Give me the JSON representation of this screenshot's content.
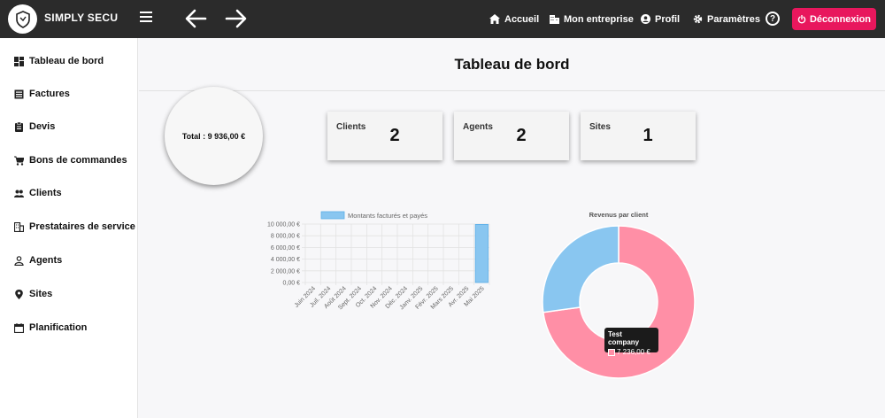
{
  "header": {
    "brand": "SIMPLY SECU",
    "logo_text": "SIMPLY SECU",
    "nav": [
      {
        "label": "Accueil",
        "icon": "home-icon"
      },
      {
        "label": "Mon entreprise",
        "icon": "building-icon"
      },
      {
        "label": "Profil",
        "icon": "user-icon"
      },
      {
        "label": "Paramètres",
        "icon": "gear-icon"
      }
    ],
    "help": "?",
    "logout": "Déconnexion"
  },
  "sidebar": {
    "items": [
      {
        "label": "Tableau de bord",
        "icon": "dashboard-icon"
      },
      {
        "label": "Factures",
        "icon": "invoice-icon"
      },
      {
        "label": "Devis",
        "icon": "clipboard-icon"
      },
      {
        "label": "Bons de commandes",
        "icon": "cart-icon"
      },
      {
        "label": "Clients",
        "icon": "people-icon"
      },
      {
        "label": "Prestataires de service",
        "icon": "building-icon"
      },
      {
        "label": "Agents",
        "icon": "person-icon"
      },
      {
        "label": "Sites",
        "icon": "pin-icon"
      },
      {
        "label": "Planification",
        "icon": "calendar-icon"
      }
    ]
  },
  "main": {
    "title": "Tableau de bord",
    "total": "Total : 9 936,00 €",
    "cards": [
      {
        "label": "Clients",
        "value": "2"
      },
      {
        "label": "Agents",
        "value": "2"
      },
      {
        "label": "Sites",
        "value": "1"
      }
    ]
  },
  "chart_data": [
    {
      "type": "bar",
      "legend": "Montants facturés et payés",
      "categories": [
        "Juin 2024",
        "Juil. 2024",
        "Août 2024",
        "Sept. 2024",
        "Oct. 2024",
        "Nov. 2024",
        "Déc. 2024",
        "Janv. 2025",
        "Févr. 2025",
        "Mars 2025",
        "Avr. 2025",
        "Mai 2025"
      ],
      "series": [
        {
          "name": "Montants facturés et payés",
          "values": [
            0,
            0,
            0,
            0,
            0,
            0,
            0,
            0,
            0,
            0,
            0,
            9936
          ]
        }
      ],
      "y_ticks": [
        "10 000,00 €",
        "8 000,00 €",
        "6 000,00 €",
        "4 000,00 €",
        "2 000,00 €",
        "0,00 €"
      ],
      "ylim": [
        0,
        10000
      ],
      "color": "#89c6f0",
      "grid": true
    },
    {
      "type": "pie",
      "title": "Revenus par client",
      "slices": [
        {
          "label": "Test company",
          "value": 7236,
          "color": "#ff8fa6"
        },
        {
          "label": "",
          "value": 2700,
          "color": "#89c6f0"
        }
      ],
      "tooltip": {
        "title": "Test company",
        "value": "7 236,00 €"
      }
    }
  ]
}
